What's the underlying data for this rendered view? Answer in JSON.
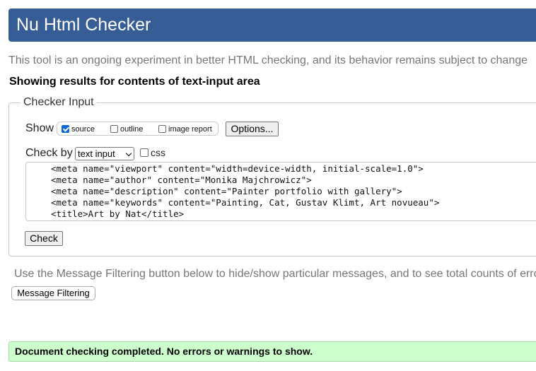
{
  "header": {
    "title": "Nu Html Checker"
  },
  "tagline": "This tool is an ongoing experiment in better HTML checking, and its behavior remains subject to change",
  "showing_results": "Showing results for contents of text-input area",
  "checker_input": {
    "legend": "Checker Input",
    "show_label": "Show",
    "show_options": [
      {
        "label": "source",
        "checked": true
      },
      {
        "label": "outline",
        "checked": false
      },
      {
        "label": "image report",
        "checked": false
      }
    ],
    "options_button": "Options...",
    "check_by_label": "Check by",
    "check_by_value": "text input",
    "css_label": "css",
    "css_checked": false,
    "code_lines": [
      "<meta name=\"viewport\" content=\"width=device-width, initial-scale=1.0\">",
      "<meta name=\"author\" content=\"Monika Majchrowicz\">",
      "<meta name=\"description\" content=\"Painter portfolio with gallery\">",
      "<meta name=\"keywords\" content=\"Painting, Cat, Gustav Klimt, Art novueau\">",
      "<title>Art by Nat</title>"
    ],
    "check_button": "Check"
  },
  "filter_note": "Use the Message Filtering button below to hide/show particular messages, and to see total counts of errors",
  "message_filtering_button": "Message Filtering",
  "result_message": "Document checking completed. No errors or warnings to show.",
  "colors": {
    "header_bg": "#365D95",
    "success_bg": "#ccffcc",
    "checkbox_accent": "#0a68d6"
  }
}
